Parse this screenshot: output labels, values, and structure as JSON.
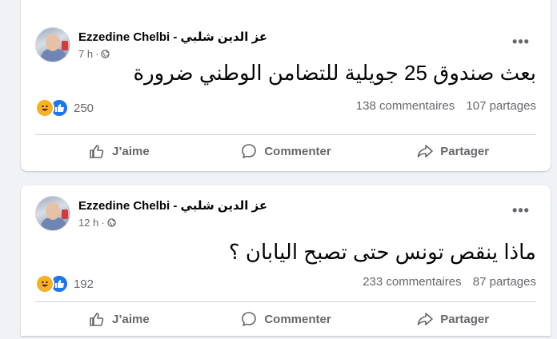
{
  "posts": [
    {
      "author": "Ezzedine Chelbi - عز الدين شلبي",
      "time": "7 h",
      "time_separator": "·",
      "text": "بعث صندوق 25 جويلية للتضامن الوطني ضرورة",
      "reaction_count": "250",
      "comments": "138 commentaires",
      "shares": "107 partages",
      "actions": {
        "like": "J’aime",
        "comment": "Commenter",
        "share": "Partager"
      }
    },
    {
      "author": "Ezzedine Chelbi - عز الدين شلبي",
      "time": "12 h",
      "time_separator": "·",
      "text": "ماذا ينقص تونس حتى تصبح اليابان ؟",
      "reaction_count": "192",
      "comments": "233 commentaires",
      "shares": "87 partages",
      "actions": {
        "like": "J’aime",
        "comment": "Commenter",
        "share": "Partager"
      }
    }
  ],
  "icons": {
    "more": "more-options-icon",
    "globe": "globe-icon",
    "haha": "haha-reaction-icon",
    "like_reaction": "like-reaction-icon",
    "like": "thumbs-up-icon",
    "comment": "comment-bubble-icon",
    "share": "share-arrow-icon"
  },
  "colors": {
    "accent": "#1877f2",
    "haha": "#f7b125",
    "muted_text": "#65676b",
    "background": "#f0f2f5"
  }
}
